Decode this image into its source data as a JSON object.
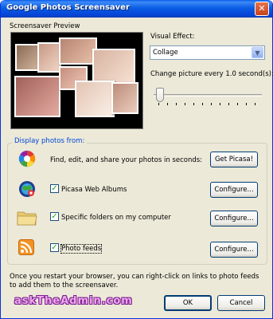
{
  "window": {
    "title": "Google Photos Screensaver",
    "close_glyph": "✕"
  },
  "preview": {
    "label": "Screensaver Preview"
  },
  "visual_effect": {
    "label": "Visual Effect:",
    "selected": "Collage",
    "arrow_glyph": "▼"
  },
  "interval": {
    "label": "Change picture every 1.0 second(s):",
    "value_seconds": 1.0
  },
  "display": {
    "label": "Display photos from:",
    "picasa_promo": {
      "text": "Find, edit, and share your photos in seconds:",
      "button": "Get Picasa!"
    },
    "sources": [
      {
        "label": "Picasa Web Albums",
        "checked": true,
        "button": "Configure..."
      },
      {
        "label": "Specific folders on my computer",
        "checked": true,
        "button": "Configure..."
      },
      {
        "label": "Photo feeds",
        "checked": true,
        "button": "Configure..."
      }
    ]
  },
  "footer": {
    "note": "Once you restart your browser, you can right-click on links to photo feeds to add them to the screensaver.",
    "ok": "OK",
    "cancel": "Cancel"
  },
  "watermark": "askTheAdmin.com",
  "colors": {
    "titlebar": "#0A5DE3",
    "dialog_bg": "#ECE9D8",
    "group_label": "#0046D5",
    "checkmark": "#21A121"
  }
}
